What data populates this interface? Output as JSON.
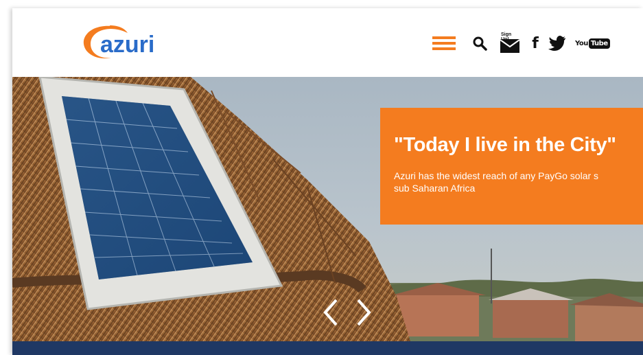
{
  "brand": {
    "logo_text": "azuri",
    "logo_color": "#f47c1f",
    "wordmark_color": "#2a6cc9"
  },
  "header": {
    "icons": [
      {
        "name": "hamburger-menu-icon",
        "color": "#f47c1f"
      },
      {
        "name": "search-icon"
      },
      {
        "name": "mail-signup-icon",
        "label": "Sign Up!"
      },
      {
        "name": "facebook-icon",
        "label": "f"
      },
      {
        "name": "twitter-icon"
      },
      {
        "name": "youtube-icon",
        "label_you": "You",
        "label_tube": "Tube"
      }
    ]
  },
  "hero": {
    "promo": {
      "title": "\"Today I live in the City\"",
      "text_line1": "Azuri has the widest reach of any PayGo solar s",
      "text_line2": "sub Saharan Africa",
      "background": "#f47c1f"
    },
    "carousel": {
      "prev_icon": "chevron-left-icon",
      "next_icon": "chevron-right-icon"
    }
  },
  "navbar": {
    "color": "#1f3864"
  }
}
